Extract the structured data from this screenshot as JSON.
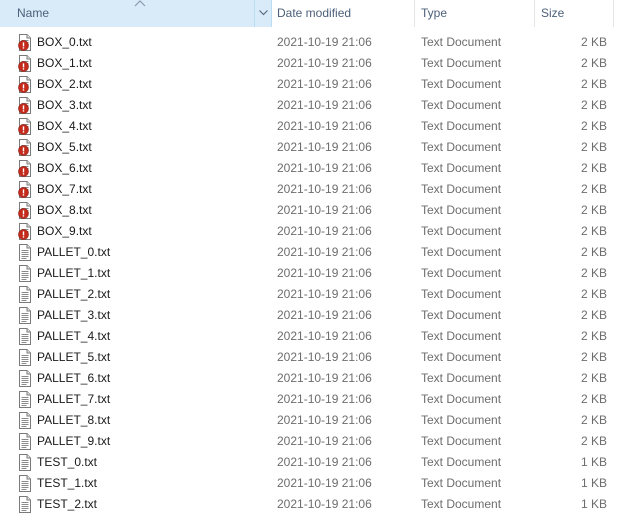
{
  "columns": {
    "name": "Name",
    "date": "Date modified",
    "type": "Type",
    "size": "Size"
  },
  "files": [
    {
      "name": "BOX_0.txt",
      "date": "2021-10-19 21:06",
      "type": "Text Document",
      "size": "2 KB",
      "icon": "text-file-warning-icon"
    },
    {
      "name": "BOX_1.txt",
      "date": "2021-10-19 21:06",
      "type": "Text Document",
      "size": "2 KB",
      "icon": "text-file-warning-icon"
    },
    {
      "name": "BOX_2.txt",
      "date": "2021-10-19 21:06",
      "type": "Text Document",
      "size": "2 KB",
      "icon": "text-file-warning-icon"
    },
    {
      "name": "BOX_3.txt",
      "date": "2021-10-19 21:06",
      "type": "Text Document",
      "size": "2 KB",
      "icon": "text-file-warning-icon"
    },
    {
      "name": "BOX_4.txt",
      "date": "2021-10-19 21:06",
      "type": "Text Document",
      "size": "2 KB",
      "icon": "text-file-warning-icon"
    },
    {
      "name": "BOX_5.txt",
      "date": "2021-10-19 21:06",
      "type": "Text Document",
      "size": "2 KB",
      "icon": "text-file-warning-icon"
    },
    {
      "name": "BOX_6.txt",
      "date": "2021-10-19 21:06",
      "type": "Text Document",
      "size": "2 KB",
      "icon": "text-file-warning-icon"
    },
    {
      "name": "BOX_7.txt",
      "date": "2021-10-19 21:06",
      "type": "Text Document",
      "size": "2 KB",
      "icon": "text-file-warning-icon"
    },
    {
      "name": "BOX_8.txt",
      "date": "2021-10-19 21:06",
      "type": "Text Document",
      "size": "2 KB",
      "icon": "text-file-warning-icon"
    },
    {
      "name": "BOX_9.txt",
      "date": "2021-10-19 21:06",
      "type": "Text Document",
      "size": "2 KB",
      "icon": "text-file-warning-icon"
    },
    {
      "name": "PALLET_0.txt",
      "date": "2021-10-19 21:06",
      "type": "Text Document",
      "size": "2 KB",
      "icon": "text-file-icon"
    },
    {
      "name": "PALLET_1.txt",
      "date": "2021-10-19 21:06",
      "type": "Text Document",
      "size": "2 KB",
      "icon": "text-file-icon"
    },
    {
      "name": "PALLET_2.txt",
      "date": "2021-10-19 21:06",
      "type": "Text Document",
      "size": "2 KB",
      "icon": "text-file-icon"
    },
    {
      "name": "PALLET_3.txt",
      "date": "2021-10-19 21:06",
      "type": "Text Document",
      "size": "2 KB",
      "icon": "text-file-icon"
    },
    {
      "name": "PALLET_4.txt",
      "date": "2021-10-19 21:06",
      "type": "Text Document",
      "size": "2 KB",
      "icon": "text-file-icon"
    },
    {
      "name": "PALLET_5.txt",
      "date": "2021-10-19 21:06",
      "type": "Text Document",
      "size": "2 KB",
      "icon": "text-file-icon"
    },
    {
      "name": "PALLET_6.txt",
      "date": "2021-10-19 21:06",
      "type": "Text Document",
      "size": "2 KB",
      "icon": "text-file-icon"
    },
    {
      "name": "PALLET_7.txt",
      "date": "2021-10-19 21:06",
      "type": "Text Document",
      "size": "2 KB",
      "icon": "text-file-icon"
    },
    {
      "name": "PALLET_8.txt",
      "date": "2021-10-19 21:06",
      "type": "Text Document",
      "size": "2 KB",
      "icon": "text-file-icon"
    },
    {
      "name": "PALLET_9.txt",
      "date": "2021-10-19 21:06",
      "type": "Text Document",
      "size": "2 KB",
      "icon": "text-file-icon"
    },
    {
      "name": "TEST_0.txt",
      "date": "2021-10-19 21:06",
      "type": "Text Document",
      "size": "1 KB",
      "icon": "text-file-icon"
    },
    {
      "name": "TEST_1.txt",
      "date": "2021-10-19 21:06",
      "type": "Text Document",
      "size": "1 KB",
      "icon": "text-file-icon"
    },
    {
      "name": "TEST_2.txt",
      "date": "2021-10-19 21:06",
      "type": "Text Document",
      "size": "1 KB",
      "icon": "text-file-icon"
    }
  ],
  "colors": {
    "header_selected_bg": "#d9ebf9",
    "header_text": "#4c607a",
    "warning_badge": "#c42b1c",
    "secondary_text": "#6d6d6d"
  }
}
